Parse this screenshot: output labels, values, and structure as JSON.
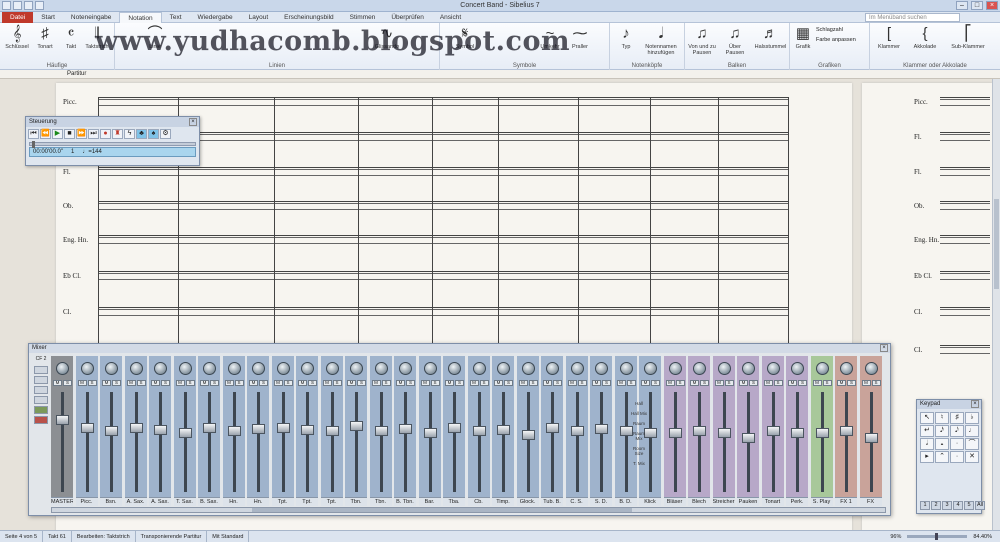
{
  "window": {
    "title": "Concert Band - Sibelius 7"
  },
  "watermark": "www.yudhacomb.blogspot.com",
  "tabs": [
    {
      "label": "Datei"
    },
    {
      "label": "Start"
    },
    {
      "label": "Noteneingabe"
    },
    {
      "label": "Notation"
    },
    {
      "label": "Text"
    },
    {
      "label": "Wiedergabe"
    },
    {
      "label": "Layout"
    },
    {
      "label": "Erscheinungsbild"
    },
    {
      "label": "Stimmen"
    },
    {
      "label": "Überprüfen"
    },
    {
      "label": "Ansicht"
    }
  ],
  "search": {
    "placeholder": "Im Menüband suchen"
  },
  "ribbon": {
    "groups": [
      {
        "title": "Häufige",
        "buttons": [
          "Schlüssel",
          "Tonart",
          "Takt",
          "Taktstrich"
        ]
      },
      {
        "title": "Linien",
        "buttons": [
          "Linie",
          "Glissando"
        ]
      },
      {
        "title": "Symbole",
        "buttons": [
          "Symbol",
          "Umkehr",
          "Praller"
        ]
      },
      {
        "title": "Notenköpfe",
        "buttons": [
          "Typ",
          "Notennamen hinzufügen"
        ]
      },
      {
        "title": "Balken",
        "buttons": [
          "Von und zu Pausen",
          "Über Pausen",
          "Halsstummel"
        ]
      },
      {
        "title": "Grafiken",
        "buttons": [
          "Grafik",
          "Schlagzahl",
          "Farbe anpassen"
        ]
      },
      {
        "title": "Klammer oder Akkolade",
        "buttons": [
          "Klammer",
          "Akkolade",
          "Sub-Klammer"
        ]
      }
    ]
  },
  "document": {
    "view_label": "Partitur"
  },
  "score": {
    "instruments": [
      "Picc.",
      "Fl.",
      "Fl.",
      "Ob.",
      "Eng. Hn.",
      "Eb Cl.",
      "Cl.",
      "Cl."
    ],
    "instruments_page2": [
      "Picc.",
      "Fl.",
      "Fl.",
      "Ob.",
      "Eng. Hn.",
      "Eb Cl.",
      "Cl.",
      "Cl."
    ]
  },
  "transport": {
    "title": "Steuerung",
    "time": "00:00'00.0\"",
    "bar": "1",
    "tempo": "♩=144"
  },
  "mixer": {
    "title": "Mixer",
    "channels": [
      {
        "name": "MASTER",
        "kind": "dark"
      },
      {
        "name": "Picc.",
        "kind": "blue"
      },
      {
        "name": "Bsn.",
        "kind": "blue"
      },
      {
        "name": "A. Sax.",
        "kind": "blue"
      },
      {
        "name": "A. Sax.",
        "kind": "blue"
      },
      {
        "name": "T. Sax.",
        "kind": "blue"
      },
      {
        "name": "B. Sax.",
        "kind": "blue"
      },
      {
        "name": "Hn.",
        "kind": "blue"
      },
      {
        "name": "Hn.",
        "kind": "blue"
      },
      {
        "name": "Tpt.",
        "kind": "blue"
      },
      {
        "name": "Tpt.",
        "kind": "blue"
      },
      {
        "name": "Tpt.",
        "kind": "blue"
      },
      {
        "name": "Tbn.",
        "kind": "blue"
      },
      {
        "name": "Tbn.",
        "kind": "blue"
      },
      {
        "name": "B. Tbn.",
        "kind": "blue"
      },
      {
        "name": "Bar.",
        "kind": "blue"
      },
      {
        "name": "Tba.",
        "kind": "blue"
      },
      {
        "name": "Cb.",
        "kind": "blue"
      },
      {
        "name": "Timp.",
        "kind": "blue"
      },
      {
        "name": "Glock.",
        "kind": "blue"
      },
      {
        "name": "Tub. B.",
        "kind": "blue"
      },
      {
        "name": "C. S.",
        "kind": "blue"
      },
      {
        "name": "S. D.",
        "kind": "blue"
      },
      {
        "name": "B. D.",
        "kind": "blue"
      },
      {
        "name": "Klick",
        "kind": "blue"
      },
      {
        "name": "Bläser",
        "kind": "purple"
      },
      {
        "name": "Blech",
        "kind": "purple"
      },
      {
        "name": "Streicher",
        "kind": "purple"
      },
      {
        "name": "Pauken",
        "kind": "purple"
      },
      {
        "name": "Tonart",
        "kind": "purple"
      },
      {
        "name": "Perk.",
        "kind": "purple"
      },
      {
        "name": "S. Play",
        "kind": "green"
      },
      {
        "name": "FX 1",
        "kind": "red"
      },
      {
        "name": "FX",
        "kind": "red"
      }
    ],
    "fader_levels": [
      0.75,
      0.66,
      0.62,
      0.66,
      0.63,
      0.6,
      0.66,
      0.62,
      0.64,
      0.66,
      0.63,
      0.62,
      0.68,
      0.62,
      0.64,
      0.6,
      0.66,
      0.62,
      0.63,
      0.58,
      0.66,
      0.62,
      0.65,
      0.62,
      0.6,
      0.6,
      0.62,
      0.6,
      0.55,
      0.62,
      0.6,
      0.6,
      0.62,
      0.55
    ],
    "fx_labels": [
      "Hall",
      "Hall Mix",
      "Raum",
      "Raum Mix",
      "Room Size",
      "T. Mix"
    ],
    "config_label": "CF 2"
  },
  "keypad": {
    "title": "Keypad",
    "keys": [
      "↖",
      "♮",
      "♯",
      "♭",
      "↵",
      "𝅘𝅥𝅯",
      "𝅘𝅥𝅮",
      "♩",
      "𝅗𝅥",
      "𝅝",
      "·",
      "⌒",
      "▸",
      "⌃",
      "·",
      "✕"
    ],
    "tabs": [
      "1",
      "2",
      "3",
      "4",
      "5",
      "All"
    ]
  },
  "status": {
    "page": "Seite 4 von 5",
    "bar": "Takt 61",
    "mode": "Bearbeiten: Taktstrich",
    "score_mode": "Transponierende Partitur",
    "layout": "Mit Standard",
    "zoom": "96%",
    "zoom2": "84.40%"
  }
}
